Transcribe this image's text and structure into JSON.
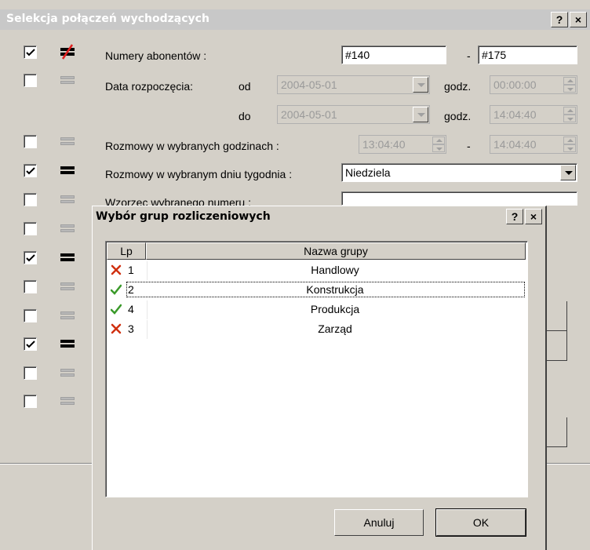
{
  "main": {
    "title": "Selekcja połączeń wychodzących",
    "help_btn": "?",
    "close_btn": "×",
    "numbers_label": "Numery abonentów :",
    "number_from": "#140",
    "number_dash": "-",
    "number_to": "#175",
    "date_label": "Data rozpoczęcia:",
    "date_from_label": "od",
    "date_from": "2004-05-01",
    "date_to_label": "do",
    "date_to": "2004-05-01",
    "time_label": "godz.",
    "time_from": "00:00:00",
    "time_to": "14:04:40",
    "hours_label": "Rozmowy w wybranych godzinach :",
    "hours_from": "13:04:40",
    "hours_dash": "-",
    "hours_to": "14:04:40",
    "weekday_label": "Rozmowy w wybranym dniu tygodnia :",
    "weekday_value": "Niedziela",
    "pattern_label": "Wzorzec wybranego numeru :",
    "row_states": [
      {
        "checked": true,
        "icon": "not-equal-icon"
      },
      {
        "checked": false,
        "icon": "equal-icon"
      },
      {
        "checked": false,
        "icon": "equal-icon"
      },
      {
        "checked": true,
        "icon": "equal-icon"
      },
      {
        "checked": false,
        "icon": "equal-icon"
      },
      {
        "checked": false,
        "icon": "equal-icon"
      },
      {
        "checked": true,
        "icon": "equal-icon"
      },
      {
        "checked": false,
        "icon": "equal-icon"
      },
      {
        "checked": false,
        "icon": "equal-icon"
      },
      {
        "checked": true,
        "icon": "equal-icon"
      },
      {
        "checked": false,
        "icon": "equal-icon"
      },
      {
        "checked": false,
        "icon": "equal-icon"
      }
    ]
  },
  "sub": {
    "title": "Wybór grup rozliczeniowych",
    "help_btn": "?",
    "close_btn": "×",
    "col_lp": "Lp",
    "col_name": "Nazwa grupy",
    "rows": [
      {
        "lp": "1",
        "name": "Handlowy",
        "status": "cross-icon"
      },
      {
        "lp": "2",
        "name": "Konstrukcja",
        "status": "check-icon"
      },
      {
        "lp": "4",
        "name": "Produkcja",
        "status": "check-icon"
      },
      {
        "lp": "3",
        "name": "Zarząd",
        "status": "cross-icon"
      }
    ],
    "cancel_btn": "Anuluj",
    "ok_btn": "OK"
  },
  "colors": {
    "check": "#3a9a2a",
    "cross": "#d03010",
    "face": "#d4d0c8"
  }
}
